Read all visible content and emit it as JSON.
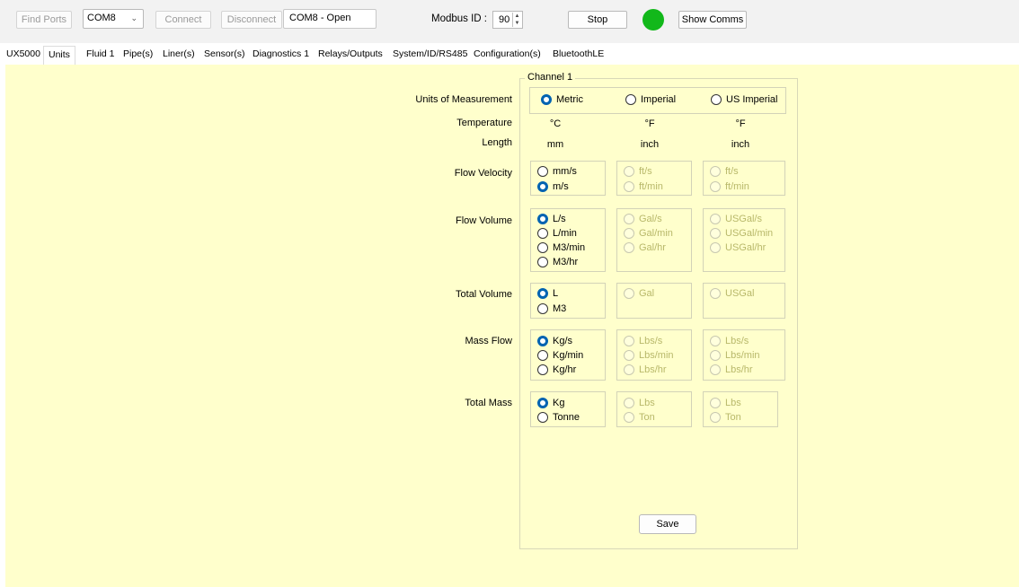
{
  "toolbar": {
    "find_ports": "Find Ports",
    "port_value": "COM8",
    "connect": "Connect",
    "disconnect": "Disconnect",
    "status": "COM8 - Open",
    "modbus_label": "Modbus ID :",
    "modbus_value": "90",
    "stop": "Stop",
    "led_color": "#12b81a",
    "show_comms": "Show Comms"
  },
  "tabs": [
    "UX5000",
    "Units",
    "Fluid 1",
    "Pipe(s)",
    "Liner(s)",
    "Sensor(s)",
    "Diagnostics 1",
    "Relays/Outputs",
    "System/ID/RS485",
    "Configuration(s)",
    "BluetoothLE"
  ],
  "active_tab": "Units",
  "channel": {
    "title": "Channel 1",
    "labels": {
      "units": "Units of Measurement",
      "temperature": "Temperature",
      "length": "Length",
      "flow_velocity": "Flow Velocity",
      "flow_volume": "Flow Volume",
      "total_volume": "Total Volume",
      "mass_flow": "Mass Flow",
      "total_mass": "Total Mass"
    },
    "systems": [
      "Metric",
      "Imperial",
      "US Imperial"
    ],
    "selected_system": "Metric",
    "temperature": [
      "°C",
      "°F",
      "°F"
    ],
    "length": [
      "mm",
      "inch",
      "inch"
    ],
    "flow_velocity": {
      "metric": [
        "mm/s",
        "m/s"
      ],
      "metric_selected": "m/s",
      "imperial": [
        "ft/s",
        "ft/min"
      ],
      "us": [
        "ft/s",
        "ft/min"
      ]
    },
    "flow_volume": {
      "metric": [
        "L/s",
        "L/min",
        "M3/min",
        "M3/hr"
      ],
      "metric_selected": "L/s",
      "imperial": [
        "Gal/s",
        "Gal/min",
        "Gal/hr"
      ],
      "us": [
        "USGal/s",
        "USGal/min",
        "USGal/hr"
      ]
    },
    "total_volume": {
      "metric": [
        "L",
        "M3"
      ],
      "metric_selected": "L",
      "imperial": [
        "Gal"
      ],
      "us": [
        "USGal"
      ]
    },
    "mass_flow": {
      "metric": [
        "Kg/s",
        "Kg/min",
        "Kg/hr"
      ],
      "metric_selected": "Kg/s",
      "imperial": [
        "Lbs/s",
        "Lbs/min",
        "Lbs/hr"
      ],
      "us": [
        "Lbs/s",
        "Lbs/min",
        "Lbs/hr"
      ]
    },
    "total_mass": {
      "metric": [
        "Kg",
        "Tonne"
      ],
      "metric_selected": "Kg",
      "imperial": [
        "Lbs",
        "Ton"
      ],
      "us": [
        "Lbs",
        "Ton"
      ]
    },
    "save": "Save"
  },
  "colors": {
    "panel_bg": "#ffffcc",
    "radio_selected": "#0063b1",
    "disabled_text": "#b8b86a"
  }
}
